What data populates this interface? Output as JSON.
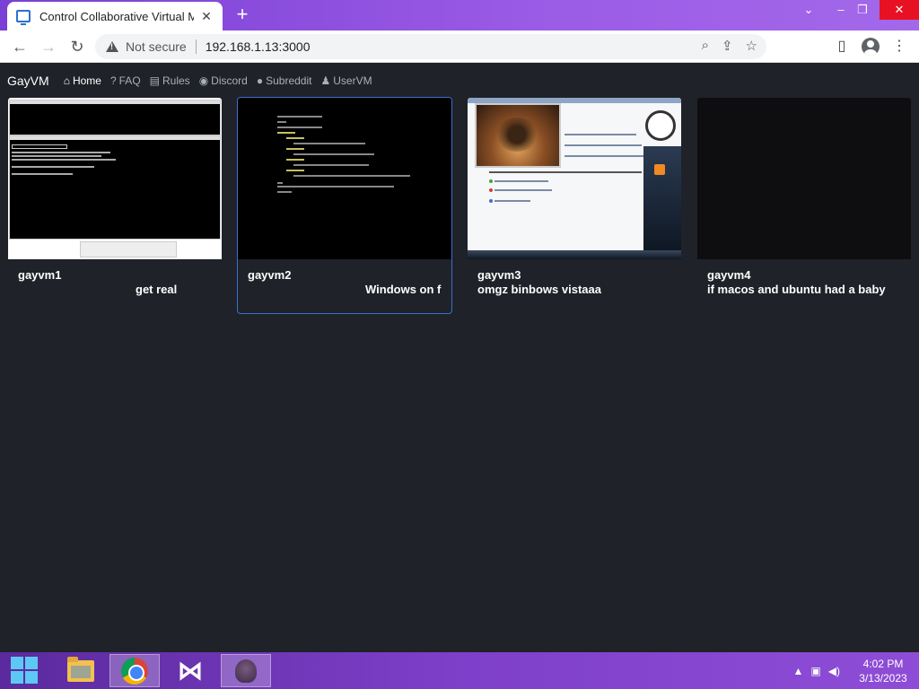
{
  "browser": {
    "tab_title": "Control Collaborative Virtual Mac",
    "tab_close": "✕",
    "new_tab": "+",
    "not_secure": "Not secure",
    "url": "192.168.1.13:3000",
    "minimize": "⌄",
    "restore": "–",
    "maximize": "❐",
    "close": "✕"
  },
  "nav": {
    "brand": "GayVM",
    "links": [
      {
        "label": "Home",
        "icon": "home-icon"
      },
      {
        "label": "FAQ",
        "icon": "question-icon"
      },
      {
        "label": "Rules",
        "icon": "clipboard-icon"
      },
      {
        "label": "Discord",
        "icon": "discord-icon"
      },
      {
        "label": "Subreddit",
        "icon": "reddit-icon"
      },
      {
        "label": "UserVM",
        "icon": "user-icon"
      }
    ]
  },
  "vms": [
    {
      "name": "gayvm1",
      "description": "get real"
    },
    {
      "name": "gayvm2",
      "description": "Windows on f"
    },
    {
      "name": "gayvm3",
      "description": "omgz binbows vistaaa"
    },
    {
      "name": "gayvm4",
      "description": "if macos and ubuntu had a baby"
    }
  ],
  "taskbar": {
    "time": "4:02 PM",
    "date": "3/13/2023",
    "apps": [
      "start-icon",
      "file-explorer-icon",
      "chrome-icon",
      "visual-studio-icon",
      "vm-app-icon"
    ]
  },
  "colors": {
    "page_bg": "#1f2228",
    "active_card_border": "#3b6fd0",
    "titlebar": "#9b5ce6"
  }
}
